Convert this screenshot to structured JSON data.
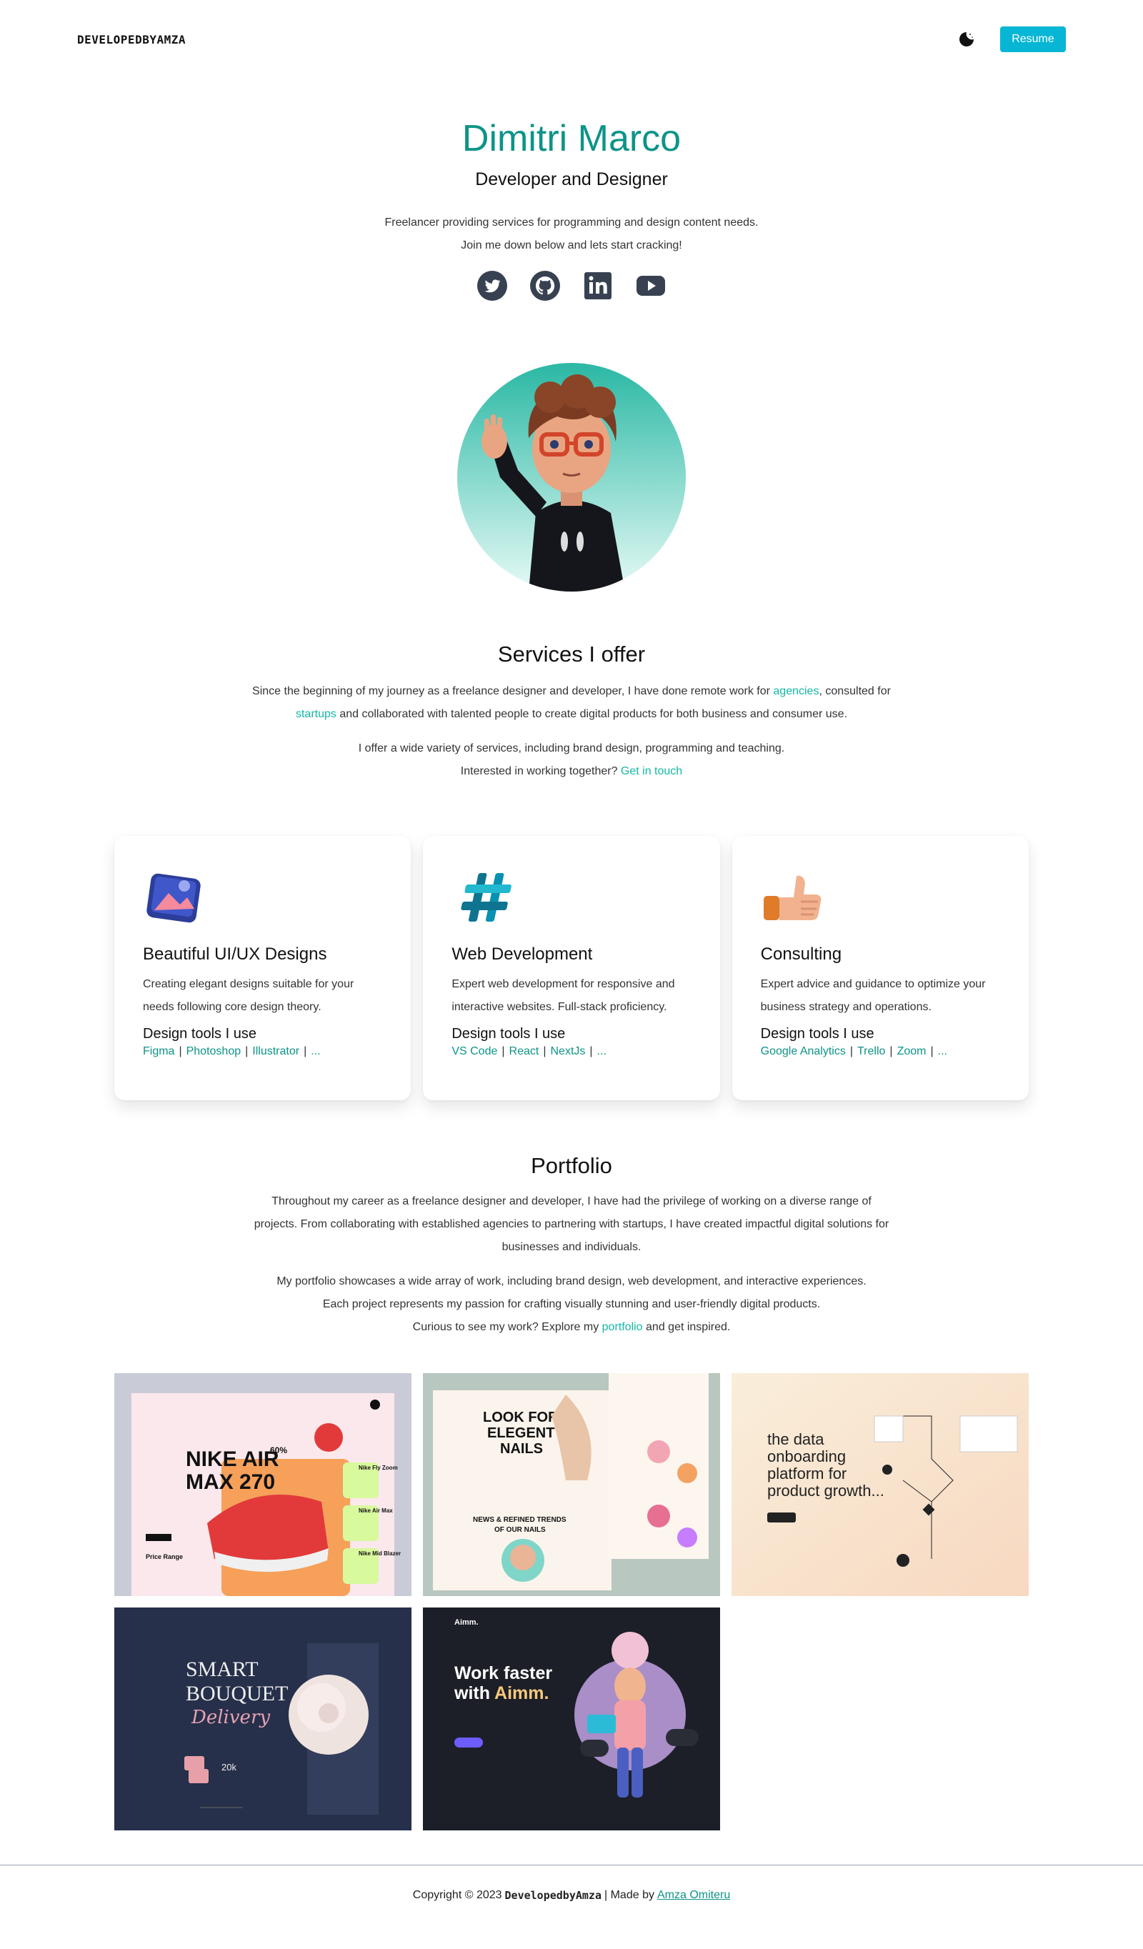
{
  "nav": {
    "brand": "DEVELOPEDBYAMZA",
    "theme_icon": "moon-icon",
    "resume_label": "Resume"
  },
  "hero": {
    "name": "Dimitri Marco",
    "role": "Developer and Designer",
    "desc_line1": "Freelancer providing services for programming and design content needs.",
    "desc_line2": "Join me down below and lets start cracking!",
    "socials": [
      "twitter-icon",
      "github-icon",
      "linkedin-icon",
      "youtube-icon"
    ]
  },
  "services": {
    "title": "Services I offer",
    "p1_a": "Since the beginning of my journey as a freelance designer and developer, I have done remote work for ",
    "p1_link1": "agencies",
    "p1_b": ", consulted for ",
    "p1_link2": "startups",
    "p1_c": " and collaborated with talented people to create digital products for both business and consumer use.",
    "p2_line1": "I offer a wide variety of services, including brand design, programming and teaching.",
    "p2_line2": "Interested in working together? ",
    "p2_link": "Get in touch"
  },
  "cards": [
    {
      "title": "Beautiful UI/UX Designs",
      "desc": "Creating elegant designs suitable for your needs following core design theory.",
      "tools_heading": "Design tools I use",
      "tools": [
        "Figma",
        "Photoshop",
        "Illustrator",
        "..."
      ]
    },
    {
      "title": "Web Development",
      "desc": "Expert web development for responsive and interactive websites. Full-stack proficiency.",
      "tools_heading": "Design tools I use",
      "tools": [
        "VS Code",
        "React",
        "NextJs",
        "..."
      ]
    },
    {
      "title": "Consulting",
      "desc": "Expert advice and guidance to optimize your business strategy and operations.",
      "tools_heading": "Design tools I use",
      "tools": [
        "Google Analytics",
        "Trello",
        "Zoom",
        "..."
      ]
    }
  ],
  "portfolio": {
    "title": "Portfolio",
    "p1": "Throughout my career as a freelance designer and developer, I have had the privilege of working on a diverse range of projects. From collaborating with established agencies to partnering with startups, I have created impactful digital solutions for businesses and individuals.",
    "p2_line1": "My portfolio showcases a wide array of work, including brand design, web development, and interactive experiences.",
    "p2_line2": "Each project represents my passion for crafting visually stunning and user-friendly digital products.",
    "p2_line3a": "Curious to see my work? Explore my ",
    "p2_link": "portfolio",
    "p2_line3b": " and get inspired.",
    "items": [
      {
        "headline1": "NIKE AIR",
        "headline2": "MAX 270",
        "stat": "60%",
        "label1": "Nike Fly Zoom",
        "label2": "Nike Air Max",
        "label3": "Nike Mid Blazer",
        "price_label": "Price Range"
      },
      {
        "headline1": "LOOK FOR",
        "headline2": "ELEGENT",
        "headline3": "NAILS",
        "sub1": "NEWS & REFINED TRENDS",
        "sub2": "OF OUR NAILS"
      },
      {
        "headline1": "the data",
        "headline2": "onboarding",
        "headline3": "platform for",
        "headline4": "product growth..."
      },
      {
        "headline1": "SMART",
        "headline2": "BOUQUET",
        "script": "Delivery",
        "stat": "20k"
      },
      {
        "brand": "Aimm.",
        "headline1": "Work faster",
        "headline2a": "with ",
        "headline2b": "Aimm."
      }
    ]
  },
  "footer": {
    "copyright": "Copyright © 2023",
    "brand": "DevelopedbyAmza",
    "made_by": "| Made by",
    "author": "Amza Omiteru"
  },
  "colors": {
    "accent": "#0d9488",
    "link": "#14b8a6",
    "button": "#06b6d4"
  }
}
